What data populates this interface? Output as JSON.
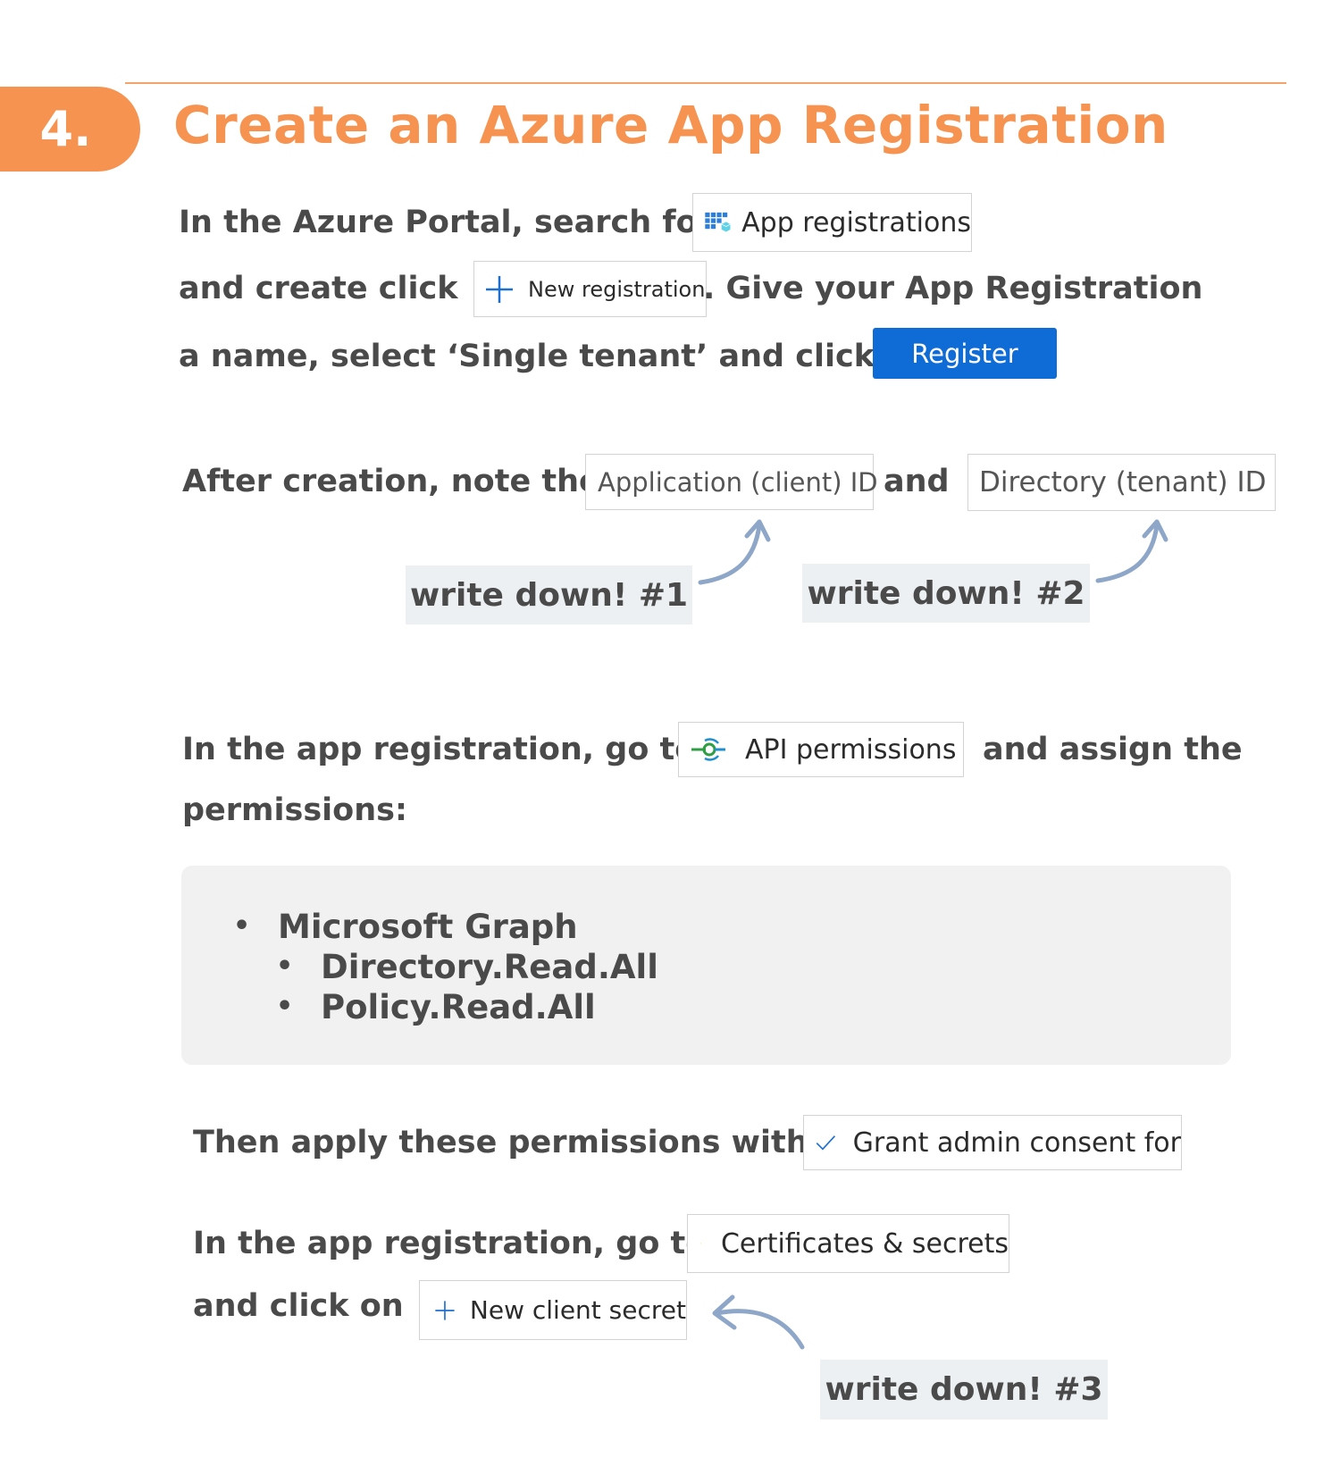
{
  "header": {
    "step_number": "4.",
    "title": "Create an Azure App Registration"
  },
  "section_registration": {
    "line1_text": "In the Azure Portal, search for",
    "app_registrations_chip": "App registrations",
    "line2_text_a": "and  create click",
    "new_registration_chip": "New registration",
    "line2_text_b": ". Give your App Registration",
    "line3_text": "a name, select  ‘Single tenant’ and click",
    "register_button": "Register"
  },
  "section_ids": {
    "text_a": "After creation, note the",
    "application_id_chip": "Application (client) ID",
    "text_and": "and",
    "directory_id_chip": "Directory (tenant) ID",
    "note1": "write down! #1",
    "note2": "write down! #2"
  },
  "section_permissions": {
    "text_a": "In the app registration, go to",
    "api_permissions_chip": "API permissions",
    "text_b": "and assign the",
    "text_c": "permissions:",
    "permissions": {
      "api": "Microsoft Graph",
      "scopes": [
        "Directory.Read.All",
        "Policy.Read.All"
      ]
    }
  },
  "section_consent": {
    "text": "Then apply these permissions with",
    "grant_chip": "Grant admin consent for"
  },
  "section_secrets": {
    "text_a": "In the app registration, go to",
    "certificates_chip": "Certificates & secrets",
    "text_b": "and click on",
    "new_secret_chip": "New client secret",
    "note3": "write down! #3"
  },
  "colors": {
    "accent_orange": "#f69350",
    "text_gray": "#4a4a4a",
    "azure_blue": "#0f6cd6",
    "note_bg": "#edf0f2",
    "arrow_blue": "#8ea6c7"
  },
  "icons": {
    "app_registrations": "app-grid-icon",
    "new_registration": "plus-icon",
    "api_permissions": "api-permissions-icon",
    "grant_consent": "checkmark-icon",
    "certificates": "key-icon",
    "new_secret": "plus-icon",
    "arrows": "curved-arrow-icon"
  }
}
